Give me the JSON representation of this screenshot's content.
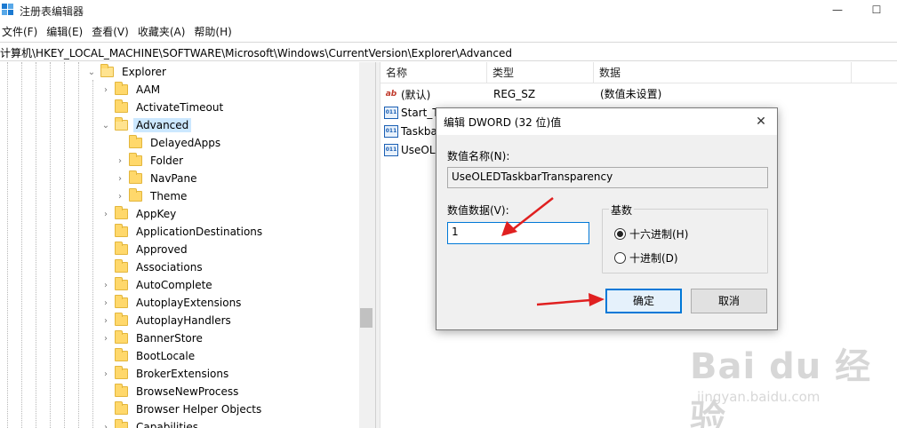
{
  "window": {
    "title": "注册表编辑器",
    "minimize_glyph": "—",
    "maximize_glyph": "☐"
  },
  "menu": [
    "文件(F)",
    "编辑(E)",
    "查看(V)",
    "收藏夹(A)",
    "帮助(H)"
  ],
  "address": "计算机\\HKEY_LOCAL_MACHINE\\SOFTWARE\\Microsoft\\Windows\\CurrentVersion\\Explorer\\Advanced",
  "tree": {
    "root": "Explorer",
    "items": [
      {
        "label": "AAM",
        "level": 1,
        "expanded": false
      },
      {
        "label": "ActivateTimeout",
        "level": 1,
        "expanded": null
      },
      {
        "label": "Advanced",
        "level": 1,
        "expanded": true,
        "selected": true
      },
      {
        "label": "DelayedApps",
        "level": 2,
        "expanded": null
      },
      {
        "label": "Folder",
        "level": 2,
        "expanded": false
      },
      {
        "label": "NavPane",
        "level": 2,
        "expanded": false
      },
      {
        "label": "Theme",
        "level": 2,
        "expanded": false
      },
      {
        "label": "AppKey",
        "level": 1,
        "expanded": false
      },
      {
        "label": "ApplicationDestinations",
        "level": 1,
        "expanded": null
      },
      {
        "label": "Approved",
        "level": 1,
        "expanded": null
      },
      {
        "label": "Associations",
        "level": 1,
        "expanded": null
      },
      {
        "label": "AutoComplete",
        "level": 1,
        "expanded": false
      },
      {
        "label": "AutoplayExtensions",
        "level": 1,
        "expanded": false
      },
      {
        "label": "AutoplayHandlers",
        "level": 1,
        "expanded": false
      },
      {
        "label": "BannerStore",
        "level": 1,
        "expanded": false
      },
      {
        "label": "BootLocale",
        "level": 1,
        "expanded": null
      },
      {
        "label": "BrokerExtensions",
        "level": 1,
        "expanded": false
      },
      {
        "label": "BrowseNewProcess",
        "level": 1,
        "expanded": null
      },
      {
        "label": "Browser Helper Objects",
        "level": 1,
        "expanded": null
      },
      {
        "label": "Capabilities",
        "level": 1,
        "expanded": false
      }
    ]
  },
  "list": {
    "columns": [
      "名称",
      "类型",
      "数据"
    ],
    "rows": [
      {
        "name": "(默认)",
        "type": "REG_SZ",
        "data": "(数值未设置)",
        "icon": "ab"
      },
      {
        "name": "Start_T",
        "type": "",
        "data": "",
        "icon": "011"
      },
      {
        "name": "Taskbar",
        "type": "",
        "data": "",
        "icon": "011"
      },
      {
        "name": "UseOLE",
        "type": "",
        "data": "",
        "icon": "011"
      }
    ]
  },
  "dialog": {
    "title": "编辑 DWORD (32 位)值",
    "close_glyph": "✕",
    "name_label": "数值名称(N):",
    "name_value": "UseOLEDTaskbarTransparency",
    "data_label": "数值数据(V):",
    "data_value": "1",
    "base_label": "基数",
    "radix_options": [
      {
        "label": "十六进制(H)",
        "checked": true
      },
      {
        "label": "十进制(D)",
        "checked": false
      }
    ],
    "ok_label": "确定",
    "cancel_label": "取消"
  },
  "watermark": {
    "brand": "Bai du 经验",
    "url": "jingyan.baidu.com"
  },
  "colors": {
    "accent": "#0078d7",
    "arrow": "#e02020",
    "selection": "#cce8ff",
    "folder": "#ffd86b"
  }
}
